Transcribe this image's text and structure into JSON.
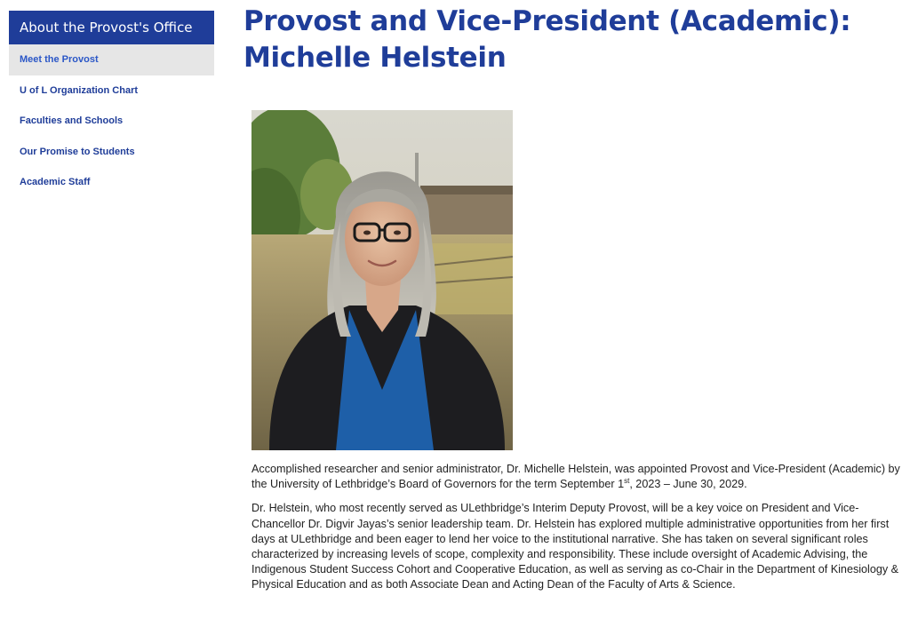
{
  "sidebar": {
    "header": "About the Provost's Office",
    "items": [
      {
        "label": "Meet the Provost",
        "active": true
      },
      {
        "label": "U of L Organization Chart",
        "active": false
      },
      {
        "label": "Faculties and Schools",
        "active": false
      },
      {
        "label": "Our Promise to Students",
        "active": false
      },
      {
        "label": "Academic Staff",
        "active": false
      }
    ]
  },
  "main": {
    "title_line1": "Provost and Vice-President (Academic):",
    "title_line2": "Michelle Helstein",
    "bio": {
      "p1_part1": "Accomplished researcher and senior administrator, Dr. Michelle Helstein, was appointed Provost and Vice-President (Academic) by the University of Lethbridge’s Board of Governors for the term September 1",
      "p1_sup": "st",
      "p1_part2": ", 2023 – June 30, 2029.",
      "p2": "Dr. Helstein, who most recently served as ULethbridge’s Interim Deputy Provost, will be a key voice on President and Vice-Chancellor Dr. Digvir Jayas’s senior leadership team. Dr. Helstein has explored multiple administrative opportunities from her first days at ULethbridge and been eager to lend her voice to the institutional narrative. She has taken on several significant roles characterized by increasing levels of scope, complexity and responsibility. These include oversight of Academic Advising, the Indigenous Student Success Cohort and Cooperative Education, as well as serving as co-Chair in the Department of Kinesiology & Physical Education and as both Associate Dean and Acting Dean of the Faculty of Arts & Science."
    }
  },
  "colors": {
    "brand_blue": "#1f3d99",
    "active_link": "#2b57c7",
    "active_bg": "#e6e6e6"
  }
}
